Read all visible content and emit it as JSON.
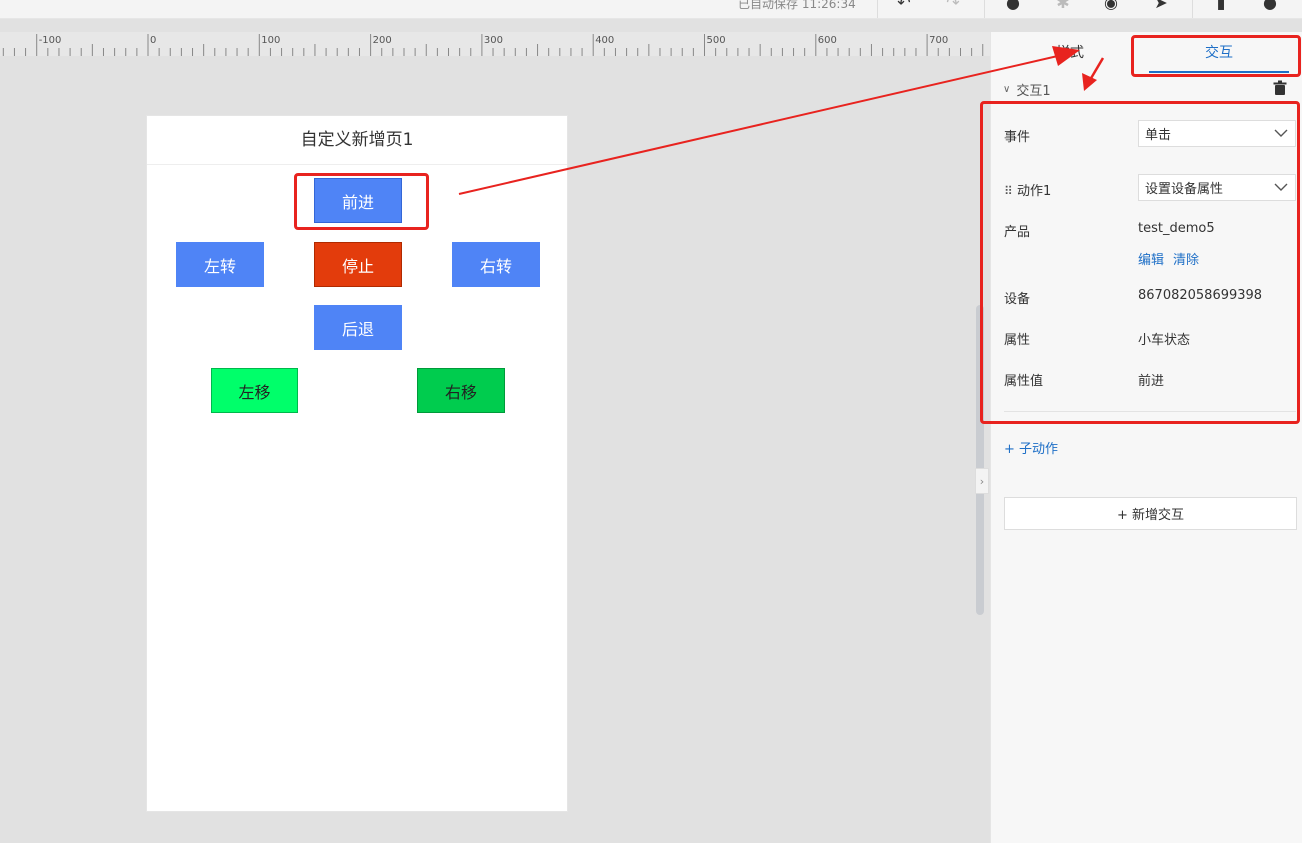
{
  "topbar": {
    "save_status": "已自动保存 11:26:34",
    "icons": [
      "undo-icon",
      "redo-icon",
      "check-circle-icon",
      "bug-icon",
      "eye-icon",
      "send-icon",
      "document-icon",
      "help-icon"
    ]
  },
  "ruler": {
    "labels": [
      "-100",
      "0",
      "100",
      "200",
      "300",
      "400",
      "500",
      "600",
      "700"
    ]
  },
  "page": {
    "title": "自定义新增页1",
    "buttons": {
      "forward": "前进",
      "left_turn": "左转",
      "stop": "停止",
      "right_turn": "右转",
      "backward": "后退",
      "move_left": "左移",
      "move_right": "右移"
    },
    "colors": {
      "blue": "#4f84f6",
      "stop": "#e33c0c",
      "bright_green": "#00ff6a",
      "green": "#00cc4e"
    }
  },
  "panel": {
    "tabs": [
      "样式",
      "交互"
    ],
    "active_tab": "交互",
    "interaction": {
      "title": "交互1",
      "event_label": "事件",
      "event_value": "单击",
      "action_label": "动作1",
      "action_value": "设置设备属性",
      "product_label": "产品",
      "product_value": "test_demo5",
      "edit_link": "编辑",
      "clear_link": "清除",
      "device_label": "设备",
      "device_value": "867082058699398",
      "property_label": "属性",
      "property_value": "小车状态",
      "property_value_label": "属性值",
      "property_value_value": "前进"
    },
    "add_sub_action": "+ 子动作",
    "add_interaction": "+ 新增交互"
  },
  "annotation_color": "#e8231f"
}
